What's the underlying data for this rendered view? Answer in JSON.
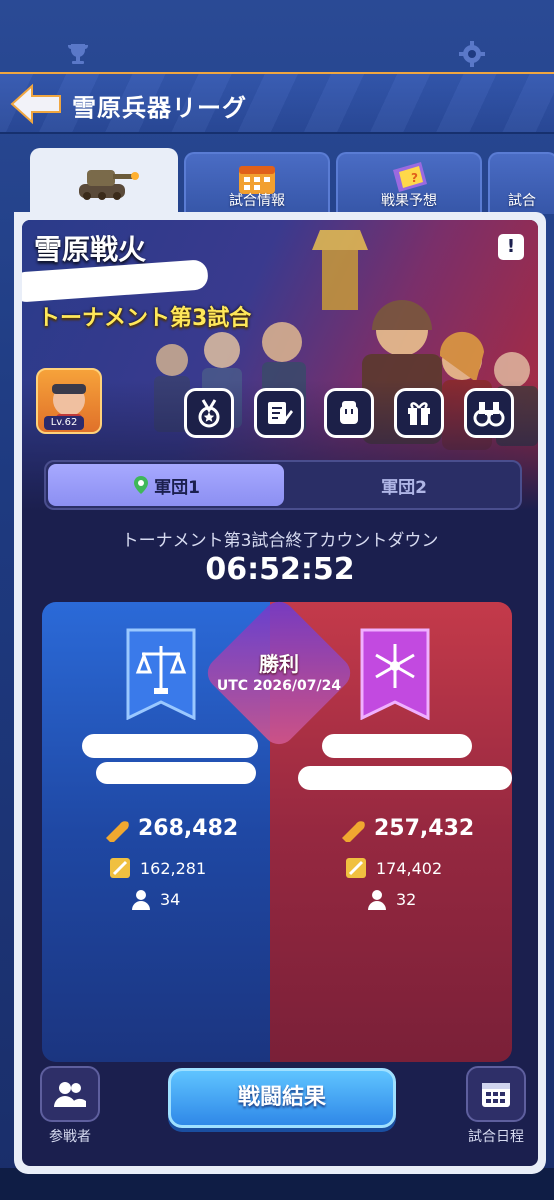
{
  "header": {
    "title": "雪原兵器リーグ"
  },
  "tabs": [
    {
      "label": ""
    },
    {
      "label": "試合情報"
    },
    {
      "label": "戦果予想"
    },
    {
      "label": "試合"
    }
  ],
  "event": {
    "name": "雪原戦火",
    "match_title": "トーナメント第3試合",
    "info_symbol": "!",
    "avatar_level": "Lv.62"
  },
  "legions": [
    {
      "label": "軍団1",
      "selected": true
    },
    {
      "label": "軍団2",
      "selected": false
    }
  ],
  "countdown": {
    "label": "トーナメント第3試合終了カウントダウン",
    "time": "06:52:52"
  },
  "result": {
    "label": "勝利",
    "date": "UTC 2026/07/24"
  },
  "teams": {
    "left": {
      "power": "268,482",
      "score": "162,281",
      "members": "34",
      "color": "#2b6ad8"
    },
    "right": {
      "power": "257,432",
      "score": "174,402",
      "members": "32",
      "color": "#c43a4a"
    }
  },
  "bottom": {
    "participants_label": "参戦者",
    "battle_result_label": "戦闘結果",
    "schedule_label": "試合日程"
  }
}
